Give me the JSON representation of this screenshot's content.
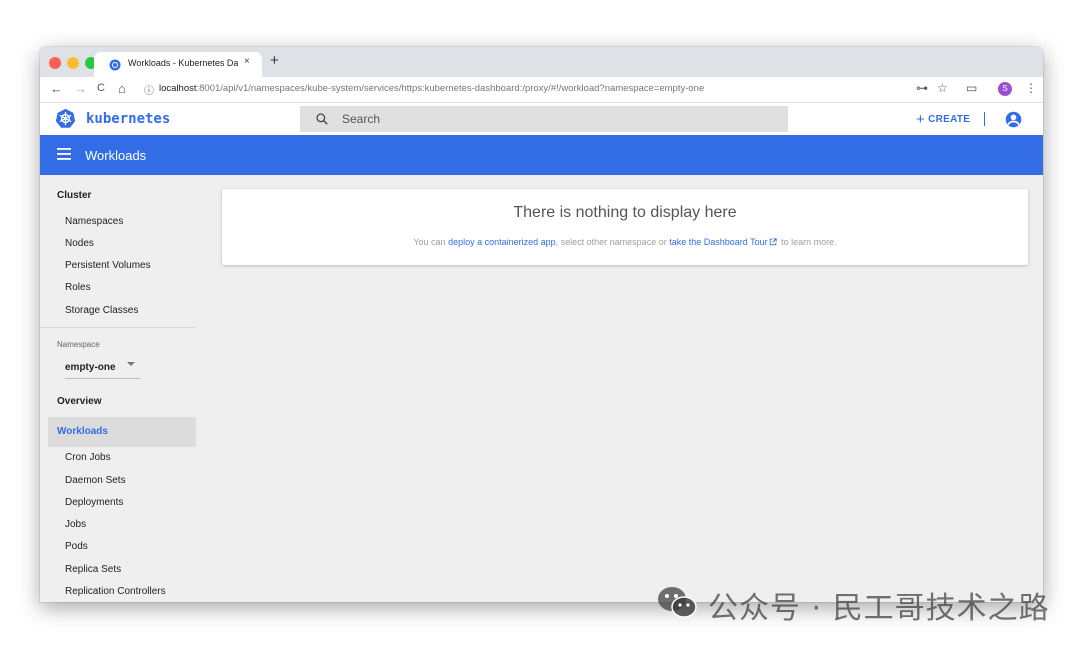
{
  "browser": {
    "tab_title": "Workloads - Kubernetes Dashb",
    "tab_close": "×",
    "new_tab": "+",
    "back": "←",
    "forward": "→",
    "reload": "C",
    "home": "⌂",
    "info": "ⓘ",
    "url_host": "localhost",
    "url_rest": ":8001/api/v1/namespaces/kube-system/services/https:kubernetes-dashboard:/proxy/#!/workload?namespace=empty-one",
    "key_icon": "⊶",
    "star_icon": "☆",
    "cast_icon": "▭",
    "profile_letter": "S",
    "menu_icon": "⋮"
  },
  "header": {
    "brand": "kubernetes",
    "search_placeholder": "Search",
    "create_label": "CREATE",
    "create_plus": "+"
  },
  "toolbar": {
    "title": "Workloads"
  },
  "sidebar": {
    "cluster_heading": "Cluster",
    "cluster_items": [
      "Namespaces",
      "Nodes",
      "Persistent Volumes",
      "Roles",
      "Storage Classes"
    ],
    "namespace_label": "Namespace",
    "namespace_value": "empty-one",
    "overview": "Overview",
    "workloads": "Workloads",
    "workload_items": [
      "Cron Jobs",
      "Daemon Sets",
      "Deployments",
      "Jobs",
      "Pods",
      "Replica Sets",
      "Replication Controllers"
    ]
  },
  "empty_state": {
    "title": "There is nothing to display here",
    "msg_prefix": "You can ",
    "link_deploy": "deploy a containerized app",
    "msg_middle": ", select other namespace or ",
    "link_tour": "take the Dashboard Tour",
    "msg_suffix": " to learn more."
  },
  "watermark": {
    "text": "公众号 · 民工哥技术之路"
  },
  "colors": {
    "brand_blue": "#326de6",
    "active_bg": "#dcdcdc",
    "content_bg": "#efefef"
  }
}
